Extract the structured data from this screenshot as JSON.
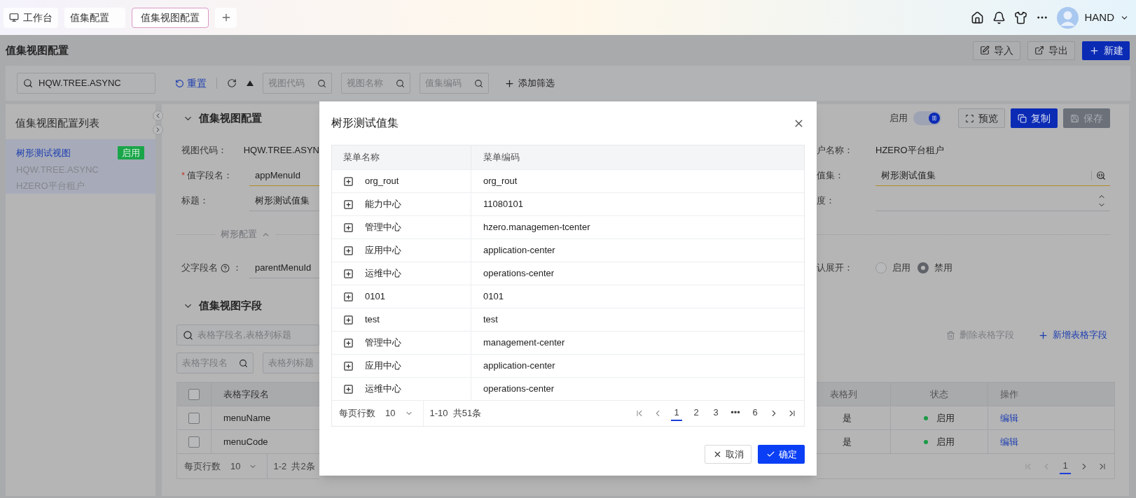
{
  "top_bar": {
    "tabs": [
      {
        "label": "工作台",
        "kind": "home",
        "selected": false
      },
      {
        "label": "值集配置",
        "kind": "page",
        "selected": false
      },
      {
        "label": "值集视图配置",
        "kind": "page",
        "selected": true
      }
    ],
    "user": {
      "name": "HAND"
    }
  },
  "page": {
    "title": "值集视图配置",
    "actions": [
      {
        "label": "导入",
        "kind": "import"
      },
      {
        "label": "导出",
        "kind": "export"
      },
      {
        "label": "新建",
        "kind": "new"
      }
    ]
  },
  "filter_bar": {
    "search": {
      "value": "HQW.TREE.ASYNC"
    },
    "reset": "重置",
    "fields": [
      {
        "placeholder": "视图代码"
      },
      {
        "placeholder": "视图名称"
      },
      {
        "placeholder": "值集编码"
      }
    ],
    "add_filter": "添加筛选"
  },
  "list_panel": {
    "title": "值集视图配置列表",
    "items": [
      {
        "name": "树形测试视图",
        "code": "HQW.TREE.ASYNC",
        "tenant": "HZERO平台租户",
        "status": "启用",
        "selected": true
      }
    ]
  },
  "detail": {
    "section_1": {
      "title": "值集视图配置",
      "expanded": true
    },
    "enabled_switch": {
      "label": "启用",
      "on": true
    },
    "toolbar": [
      {
        "label": "预览",
        "kind": "preview",
        "disabled": false
      },
      {
        "label": "复制",
        "kind": "copy",
        "disabled": false
      },
      {
        "label": "保存",
        "kind": "save",
        "disabled": true
      }
    ],
    "form_left": [
      {
        "label": "视图代码：",
        "value": "HQW.TREE.ASYN",
        "kind": "text"
      },
      {
        "required_mark": "*",
        "label": "值字段名：",
        "value": "appMenuId",
        "kind": "input"
      },
      {
        "label": "标题：",
        "value": "树形测试值集",
        "kind": "input"
      }
    ],
    "form_right": [
      {
        "label": "户名称：",
        "value": "HZERO平台租户",
        "kind": "text"
      },
      {
        "label": "值集：",
        "value": "树形测试值集",
        "kind": "lov"
      },
      {
        "label": "度：",
        "kind": "number"
      }
    ],
    "tree_config": {
      "label": "树形配置",
      "expanded": true
    },
    "parent_field": {
      "label": "父字段名",
      "suffix": "：",
      "value": "parentMenuId"
    },
    "default_expand": {
      "label": "认展开：",
      "options": [
        {
          "label": "启用",
          "selected": false
        },
        {
          "label": "禁用",
          "selected": true
        }
      ]
    },
    "section_2": {
      "title": "值集视图字段",
      "expanded": true
    },
    "field_search": {
      "placeholder": "表格字段名,表格列标题"
    },
    "field_filters": [
      {
        "placeholder": "表格字段名",
        "kind": "search"
      },
      {
        "placeholder": "表格列标题",
        "kind": "plain"
      }
    ],
    "field_actions": [
      {
        "label": "删除表格字段",
        "kind": "delete",
        "disabled": true
      },
      {
        "label": "新增表格字段",
        "kind": "add",
        "disabled": false
      }
    ],
    "fields_table": {
      "all_checked": false,
      "columns_left": [
        "表格字段名"
      ],
      "columns_right": [
        "表格列",
        "状态",
        "操作"
      ],
      "rows": [
        {
          "checked": false,
          "name": "menuName",
          "column": "是",
          "status": "启用",
          "action": "编辑"
        },
        {
          "checked": false,
          "name": "menuCode",
          "column": "是",
          "status": "启用",
          "action": "编辑"
        }
      ]
    },
    "pagination": {
      "page_size_label": "每页行数",
      "page_size": "10",
      "range": "1-2  共2条",
      "pages": [
        {
          "label": "1",
          "selected": true
        }
      ]
    }
  },
  "dialog": {
    "title": "树形测试值集",
    "columns": [
      "菜单名称",
      "菜单编码"
    ],
    "rows": [
      {
        "name": "org_rout",
        "code": "org_rout",
        "expanded": false
      },
      {
        "name": "能力中心",
        "code": "11080101",
        "expanded": false
      },
      {
        "name": "管理中心",
        "code": "hzero.managemen-tcenter",
        "expanded": false
      },
      {
        "name": "应用中心",
        "code": "application-center",
        "expanded": false
      },
      {
        "name": "运维中心",
        "code": "operations-center",
        "expanded": false
      },
      {
        "name": "0101",
        "code": "0101",
        "expanded": false
      },
      {
        "name": "test",
        "code": "test",
        "expanded": false
      },
      {
        "name": "管理中心",
        "code": "management-center",
        "expanded": false
      },
      {
        "name": "应用中心",
        "code": "application-center",
        "expanded": false
      },
      {
        "name": "运维中心",
        "code": "operations-center",
        "expanded": false
      }
    ],
    "pagination": {
      "page_size_label": "每页行数",
      "page_size": "10",
      "range": "1-10  共51条",
      "pages": [
        {
          "label": "1",
          "selected": true
        },
        {
          "label": "2",
          "selected": false
        },
        {
          "label": "3",
          "selected": false
        },
        {
          "label": "•••",
          "selected": false
        },
        {
          "label": "6",
          "selected": false
        }
      ]
    },
    "buttons": [
      {
        "label": "取消",
        "kind": "cancel"
      },
      {
        "label": "确定",
        "kind": "ok"
      }
    ]
  }
}
